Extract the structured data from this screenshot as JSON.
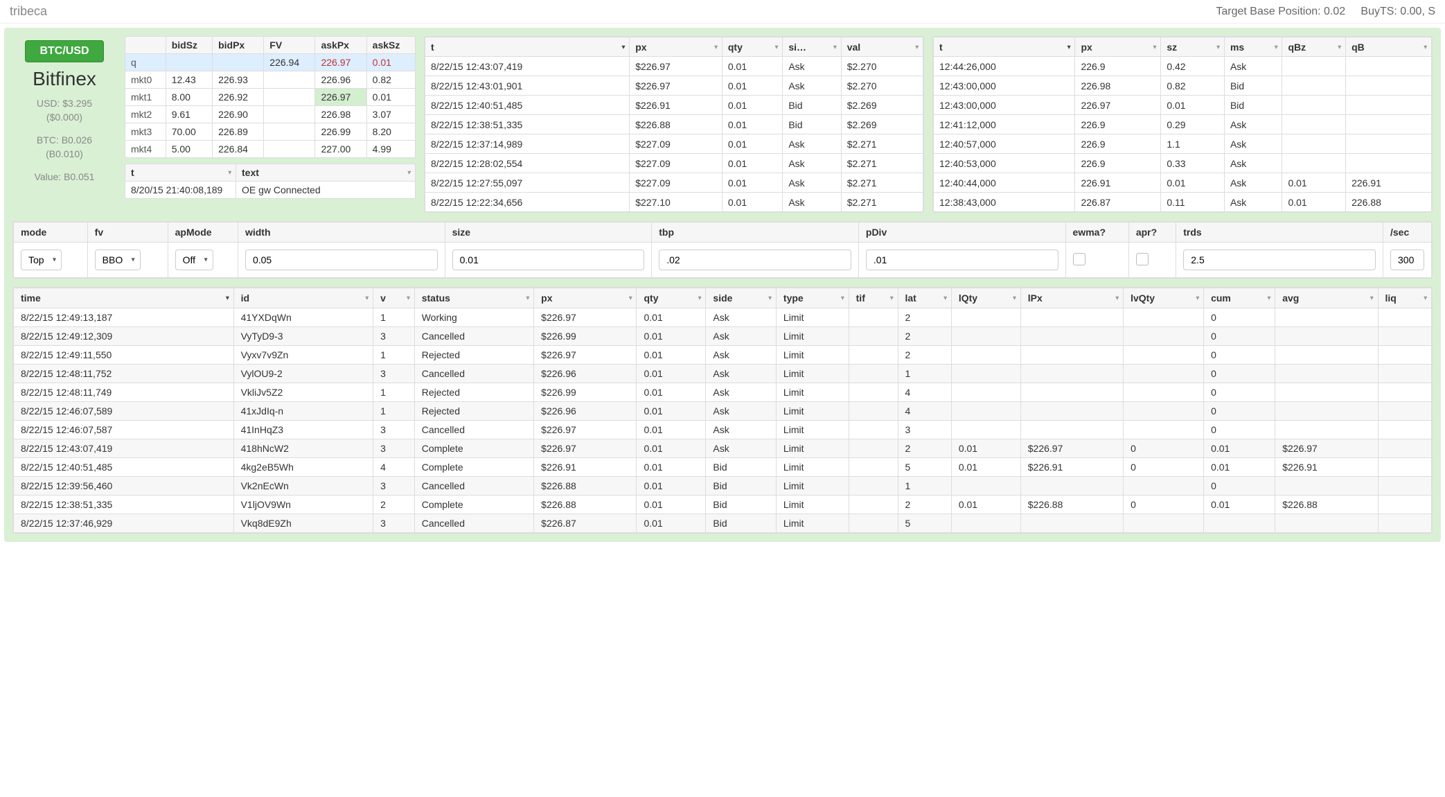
{
  "app": {
    "title": "tribeca",
    "tbp_label": "Target Base Position: 0.02",
    "buyts_label": "BuyTS: 0.00, S"
  },
  "left": {
    "pair": "BTC/USD",
    "exchange": "Bitfinex",
    "usd1": "USD: $3.295",
    "usd2": "($0.000)",
    "btc1": "BTC: B0.026",
    "btc2": "(B0.010)",
    "val": "Value: B0.051"
  },
  "market": {
    "headers": [
      "",
      "bidSz",
      "bidPx",
      "FV",
      "askPx",
      "askSz"
    ],
    "rows": [
      [
        "q",
        "",
        "",
        "226.94",
        "226.97",
        "0.01"
      ],
      [
        "mkt0",
        "12.43",
        "226.93",
        "",
        "226.96",
        "0.82"
      ],
      [
        "mkt1",
        "8.00",
        "226.92",
        "",
        "226.97",
        "0.01"
      ],
      [
        "mkt2",
        "9.61",
        "226.90",
        "",
        "226.98",
        "3.07"
      ],
      [
        "mkt3",
        "70.00",
        "226.89",
        "",
        "226.99",
        "8.20"
      ],
      [
        "mkt4",
        "5.00",
        "226.84",
        "",
        "227.00",
        "4.99"
      ]
    ]
  },
  "log": {
    "headers": [
      "t",
      "text"
    ],
    "rows": [
      [
        "8/20/15 21:40:08,189",
        "OE gw Connected"
      ]
    ]
  },
  "trades": {
    "headers": [
      "t",
      "px",
      "qty",
      "si…",
      "val"
    ],
    "rows": [
      [
        "8/22/15 12:43:07,419",
        "$226.97",
        "0.01",
        "Ask",
        "$2.270"
      ],
      [
        "8/22/15 12:43:01,901",
        "$226.97",
        "0.01",
        "Ask",
        "$2.270"
      ],
      [
        "8/22/15 12:40:51,485",
        "$226.91",
        "0.01",
        "Bid",
        "$2.269"
      ],
      [
        "8/22/15 12:38:51,335",
        "$226.88",
        "0.01",
        "Bid",
        "$2.269"
      ],
      [
        "8/22/15 12:37:14,989",
        "$227.09",
        "0.01",
        "Ask",
        "$2.271"
      ],
      [
        "8/22/15 12:28:02,554",
        "$227.09",
        "0.01",
        "Ask",
        "$2.271"
      ],
      [
        "8/22/15 12:27:55,097",
        "$227.09",
        "0.01",
        "Ask",
        "$2.271"
      ],
      [
        "8/22/15 12:22:34,656",
        "$227.10",
        "0.01",
        "Ask",
        "$2.271"
      ]
    ]
  },
  "quotes": {
    "headers": [
      "t",
      "px",
      "sz",
      "ms",
      "qBz",
      "qB"
    ],
    "rows": [
      [
        "12:44:26,000",
        "226.9",
        "0.42",
        "Ask",
        "",
        ""
      ],
      [
        "12:43:00,000",
        "226.98",
        "0.82",
        "Bid",
        "",
        ""
      ],
      [
        "12:43:00,000",
        "226.97",
        "0.01",
        "Bid",
        "",
        ""
      ],
      [
        "12:41:12,000",
        "226.9",
        "0.29",
        "Ask",
        "",
        ""
      ],
      [
        "12:40:57,000",
        "226.9",
        "1.1",
        "Ask",
        "",
        ""
      ],
      [
        "12:40:53,000",
        "226.9",
        "0.33",
        "Ask",
        "",
        ""
      ],
      [
        "12:40:44,000",
        "226.91",
        "0.01",
        "Ask",
        "0.01",
        "226.91"
      ],
      [
        "12:38:43,000",
        "226.87",
        "0.11",
        "Ask",
        "0.01",
        "226.88"
      ]
    ]
  },
  "params": {
    "headers": [
      "mode",
      "fv",
      "apMode",
      "width",
      "size",
      "tbp",
      "pDiv",
      "ewma?",
      "apr?",
      "trds",
      "/sec"
    ],
    "mode": "Top",
    "fv": "BBO",
    "apMode": "Off",
    "width": "0.05",
    "size": "0.01",
    "tbp": ".02",
    "pDiv": ".01",
    "trds": "2.5",
    "persec": "300"
  },
  "orders": {
    "headers": [
      "time",
      "id",
      "v",
      "status",
      "px",
      "qty",
      "side",
      "type",
      "tif",
      "lat",
      "lQty",
      "lPx",
      "lvQty",
      "cum",
      "avg",
      "liq"
    ],
    "rows": [
      [
        "8/22/15 12:49:13,187",
        "41YXDqWn",
        "1",
        "Working",
        "$226.97",
        "0.01",
        "Ask",
        "Limit",
        "",
        "2",
        "",
        "",
        "",
        "0",
        "",
        ""
      ],
      [
        "8/22/15 12:49:12,309",
        "VyTyD9-3",
        "3",
        "Cancelled",
        "$226.99",
        "0.01",
        "Ask",
        "Limit",
        "",
        "2",
        "",
        "",
        "",
        "0",
        "",
        ""
      ],
      [
        "8/22/15 12:49:11,550",
        "Vyxv7v9Zn",
        "1",
        "Rejected",
        "$226.97",
        "0.01",
        "Ask",
        "Limit",
        "",
        "2",
        "",
        "",
        "",
        "0",
        "",
        ""
      ],
      [
        "8/22/15 12:48:11,752",
        "VylOU9-2",
        "3",
        "Cancelled",
        "$226.96",
        "0.01",
        "Ask",
        "Limit",
        "",
        "1",
        "",
        "",
        "",
        "0",
        "",
        ""
      ],
      [
        "8/22/15 12:48:11,749",
        "VkliJv5Z2",
        "1",
        "Rejected",
        "$226.99",
        "0.01",
        "Ask",
        "Limit",
        "",
        "4",
        "",
        "",
        "",
        "0",
        "",
        ""
      ],
      [
        "8/22/15 12:46:07,589",
        "41xJdIq-n",
        "1",
        "Rejected",
        "$226.96",
        "0.01",
        "Ask",
        "Limit",
        "",
        "4",
        "",
        "",
        "",
        "0",
        "",
        ""
      ],
      [
        "8/22/15 12:46:07,587",
        "41InHqZ3",
        "3",
        "Cancelled",
        "$226.97",
        "0.01",
        "Ask",
        "Limit",
        "",
        "3",
        "",
        "",
        "",
        "0",
        "",
        ""
      ],
      [
        "8/22/15 12:43:07,419",
        "418hNcW2",
        "3",
        "Complete",
        "$226.97",
        "0.01",
        "Ask",
        "Limit",
        "",
        "2",
        "0.01",
        "$226.97",
        "0",
        "0.01",
        "$226.97",
        ""
      ],
      [
        "8/22/15 12:40:51,485",
        "4kg2eB5Wh",
        "4",
        "Complete",
        "$226.91",
        "0.01",
        "Bid",
        "Limit",
        "",
        "5",
        "0.01",
        "$226.91",
        "0",
        "0.01",
        "$226.91",
        ""
      ],
      [
        "8/22/15 12:39:56,460",
        "Vk2nEcWn",
        "3",
        "Cancelled",
        "$226.88",
        "0.01",
        "Bid",
        "Limit",
        "",
        "1",
        "",
        "",
        "",
        "0",
        "",
        ""
      ],
      [
        "8/22/15 12:38:51,335",
        "V1ljOV9Wn",
        "2",
        "Complete",
        "$226.88",
        "0.01",
        "Bid",
        "Limit",
        "",
        "2",
        "0.01",
        "$226.88",
        "0",
        "0.01",
        "$226.88",
        ""
      ],
      [
        "8/22/15 12:37:46,929",
        "Vkq8dE9Zh",
        "3",
        "Cancelled",
        "$226.87",
        "0.01",
        "Bid",
        "Limit",
        "",
        "5",
        "",
        "",
        "",
        "",
        "",
        ""
      ]
    ]
  }
}
